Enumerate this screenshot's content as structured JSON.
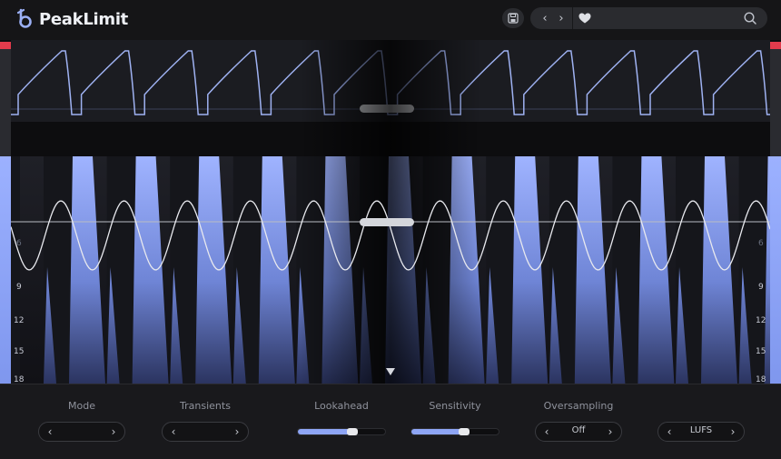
{
  "header": {
    "brand": "PeakLimit"
  },
  "meter_scale": [
    "9",
    "12",
    "15",
    "18"
  ],
  "meter_scale_partial": "6",
  "controls": {
    "mode": {
      "label": "Mode",
      "value": ""
    },
    "transients": {
      "label": "Transients",
      "value": ""
    },
    "lookahead": {
      "label": "Lookahead",
      "value": 0.62
    },
    "sensitivity": {
      "label": "Sensitivity",
      "value": 0.6
    },
    "oversampling": {
      "label": "Oversampling",
      "value": "Off"
    },
    "metering": {
      "value": "LUFS"
    }
  },
  "colors": {
    "accent": "#8ea5f5",
    "clip": "#e23b4c",
    "waveform": "#8aa0e8"
  }
}
